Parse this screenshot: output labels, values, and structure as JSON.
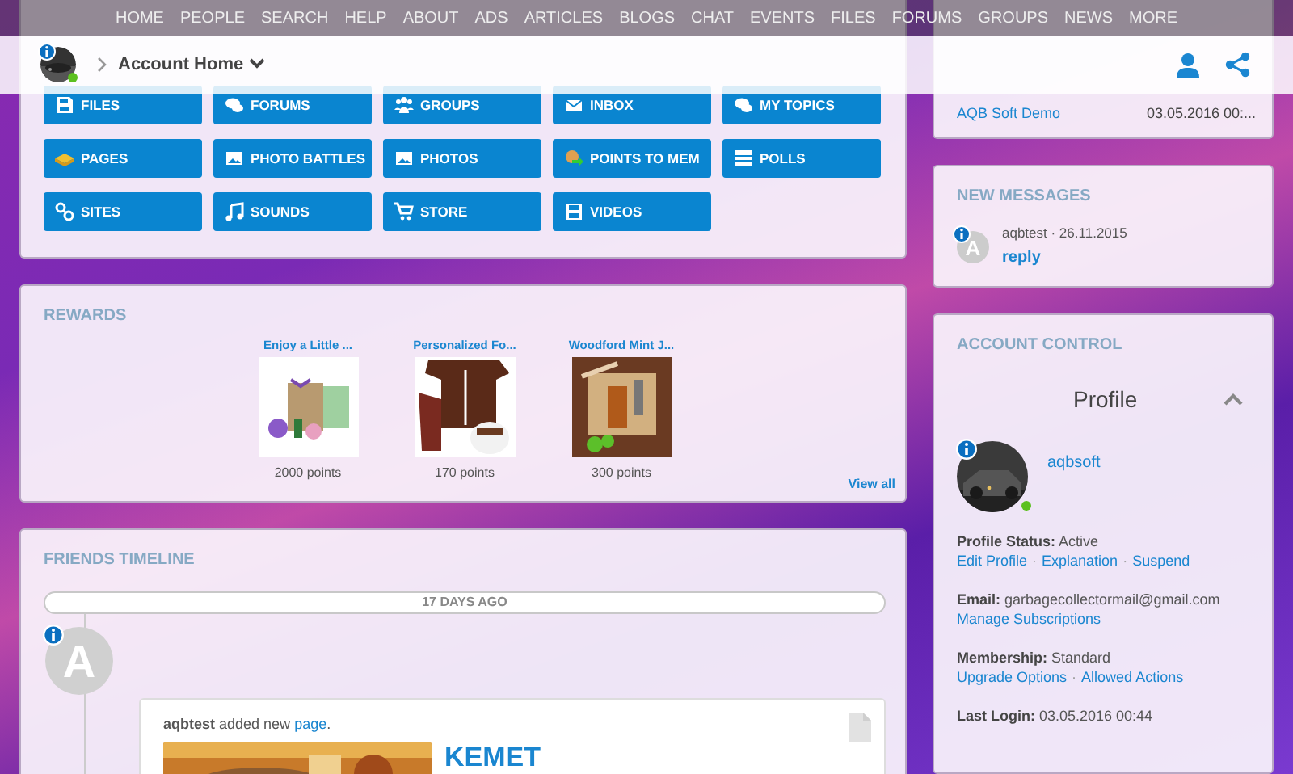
{
  "top_nav": {
    "items": [
      "HOME",
      "PEOPLE",
      "SEARCH",
      "HELP",
      "ABOUT",
      "ADS",
      "ARTICLES",
      "BLOGS",
      "CHAT",
      "EVENTS",
      "FILES",
      "FORUMS",
      "GROUPS",
      "NEWS",
      "MORE"
    ]
  },
  "account_bar": {
    "breadcrumb": "Account Home",
    "online": true
  },
  "quick_links": {
    "buttons": [
      {
        "label": "FILES"
      },
      {
        "label": "FORUMS"
      },
      {
        "label": "GROUPS"
      },
      {
        "label": "INBOX"
      },
      {
        "label": "MY TOPICS"
      },
      {
        "label": "PAGES"
      },
      {
        "label": "PHOTO BATTLES"
      },
      {
        "label": "PHOTOS"
      },
      {
        "label": "POINTS TO MEM"
      },
      {
        "label": "POLLS"
      },
      {
        "label": "SITES"
      },
      {
        "label": "SOUNDS"
      },
      {
        "label": "STORE"
      },
      {
        "label": "VIDEOS"
      }
    ]
  },
  "rewards": {
    "title": "REWARDS",
    "items": [
      {
        "title": "Enjoy a Little ...",
        "points": "2000 points"
      },
      {
        "title": "Personalized Fo...",
        "points": "170 points"
      },
      {
        "title": "Woodford Mint J...",
        "points": "300 points"
      }
    ],
    "view_all": "View all"
  },
  "friends_timeline": {
    "title": "FRIENDS TIMELINE",
    "date_divider": "17 DAYS AGO",
    "entries": [
      {
        "avatar_letter": "A",
        "sentence": "**aqbtest** added new ",
        "link": "page",
        "after": ".",
        "post_title": "KEMET"
      }
    ]
  },
  "sidebar": {
    "account_links": [
      {
        "name": "AQB Soft Demo",
        "date": "03.05.2016 00:..."
      }
    ],
    "new_messages": {
      "title": "NEW MESSAGES",
      "items": [
        {
          "avatar_letter": "A",
          "meta": "aqbtest · 26.11.2015",
          "action": "reply"
        }
      ]
    },
    "account_control": {
      "title": "ACCOUNT CONTROL",
      "heading": "Profile",
      "expanded": true,
      "username": "aqbsoft",
      "online": true,
      "separator": "·",
      "sections": [
        {
          "line": "**Profile Status:** Active",
          "links": [
            "Edit Profile",
            "Explanation",
            "Suspend"
          ]
        },
        {
          "line": "**Email:** garbagecollectormail@gmail.com",
          "links": [
            "Manage Subscriptions"
          ]
        },
        {
          "line": "**Membership:** Standard",
          "links": [
            "Upgrade Options",
            "Allowed Actions"
          ]
        },
        {
          "line": "**Last Login:** 03.05.2016 00:44"
        }
      ]
    }
  }
}
